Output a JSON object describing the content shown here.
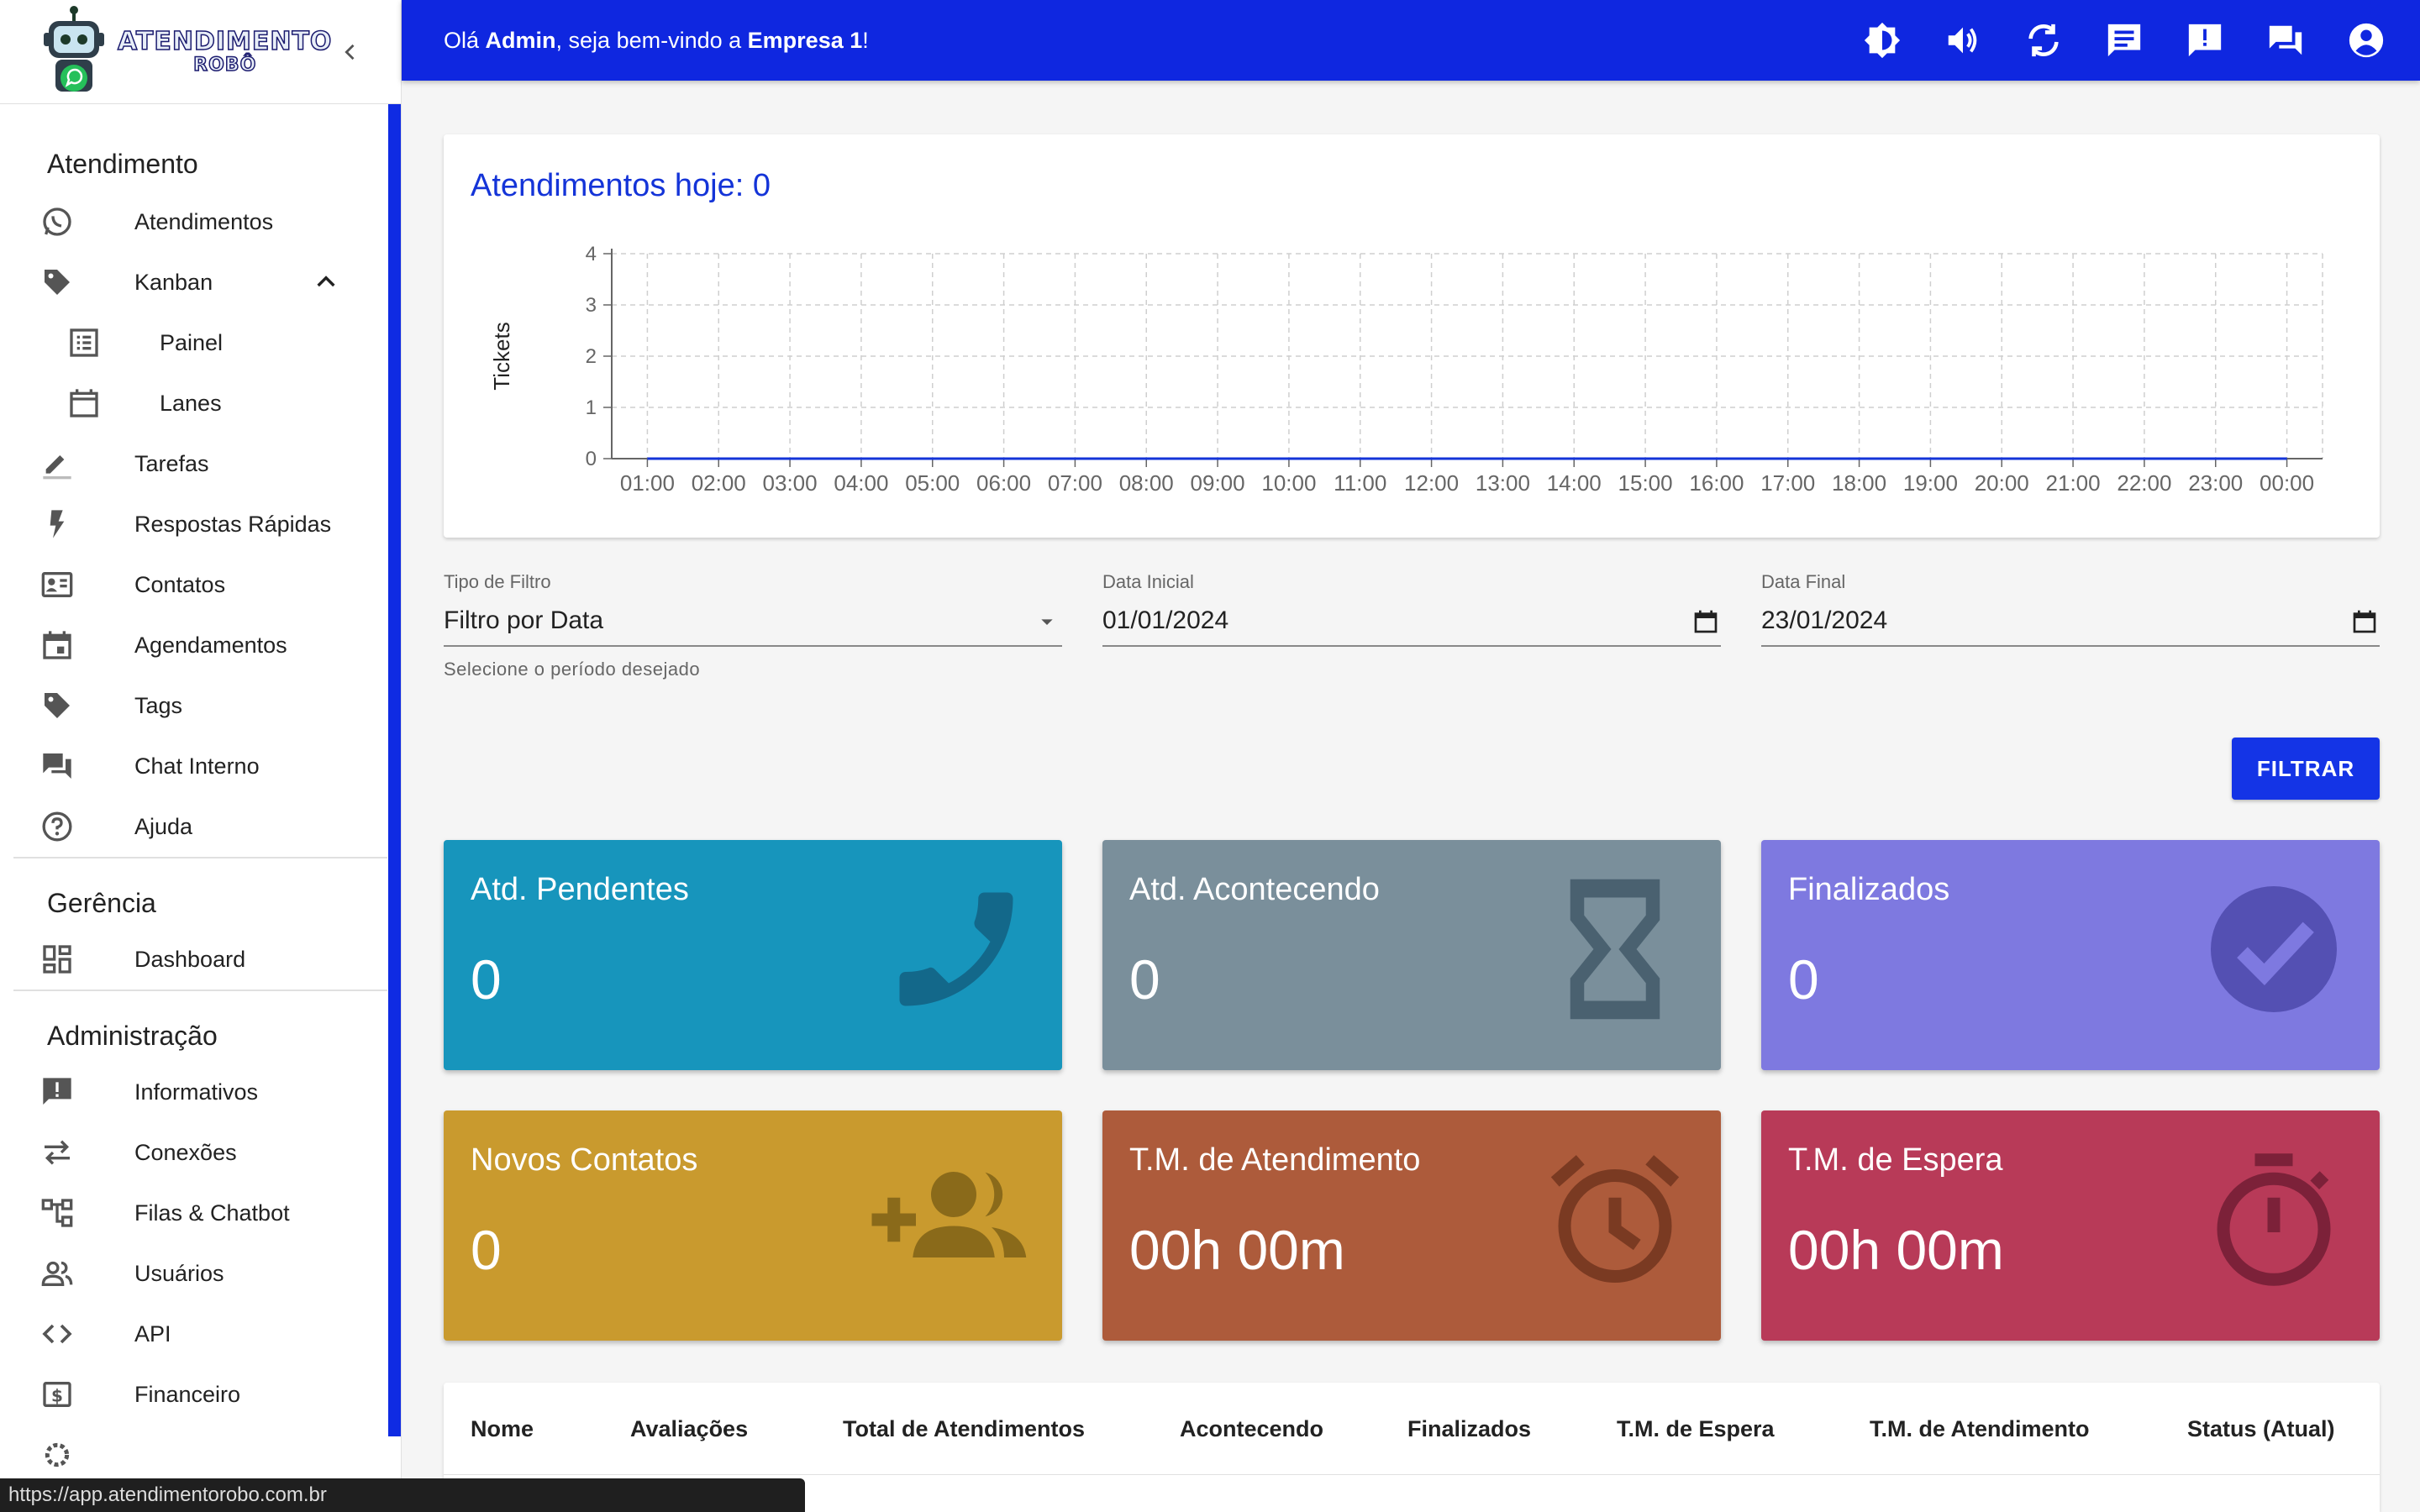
{
  "logo": {
    "line1": "ATENDIMENTO",
    "line2": "ROBÔ"
  },
  "sidebar": {
    "sections": [
      {
        "title": "Atendimento"
      },
      {
        "title": "Gerência"
      },
      {
        "title": "Administração"
      }
    ],
    "atendimento": [
      {
        "label": "Atendimentos",
        "icon": "whatsapp-icon"
      },
      {
        "label": "Kanban",
        "icon": "tag-icon"
      },
      {
        "label": "Painel",
        "icon": "list-icon"
      },
      {
        "label": "Lanes",
        "icon": "calendar-icon"
      },
      {
        "label": "Tarefas",
        "icon": "pencil-icon"
      },
      {
        "label": "Respostas Rápidas",
        "icon": "flash-icon"
      },
      {
        "label": "Contatos",
        "icon": "contact-card-icon"
      },
      {
        "label": "Agendamentos",
        "icon": "event-icon"
      },
      {
        "label": "Tags",
        "icon": "tag-icon"
      },
      {
        "label": "Chat Interno",
        "icon": "forum-icon"
      },
      {
        "label": "Ajuda",
        "icon": "help-icon"
      }
    ],
    "gerencia": [
      {
        "label": "Dashboard",
        "icon": "dashboard-icon"
      }
    ],
    "administracao": [
      {
        "label": "Informativos",
        "icon": "announcement-icon"
      },
      {
        "label": "Conexões",
        "icon": "sync-arrows-icon"
      },
      {
        "label": "Filas & Chatbot",
        "icon": "tree-icon"
      },
      {
        "label": "Usuários",
        "icon": "people-icon"
      },
      {
        "label": "API",
        "icon": "code-icon"
      },
      {
        "label": "Financeiro",
        "icon": "money-icon"
      }
    ]
  },
  "topbar": {
    "greeting_pre": "Olá ",
    "user": "Admin",
    "greeting_mid": ", seja bem-vindo a ",
    "company": "Empresa 1",
    "greeting_post": "!"
  },
  "chart_data": {
    "type": "line",
    "title": "Atendimentos hoje: 0",
    "ylabel": "Tickets",
    "xlabel": "",
    "ylim": [
      0,
      4
    ],
    "yticks": [
      "0",
      "1",
      "2",
      "3",
      "4"
    ],
    "categories": [
      "01:00",
      "02:00",
      "03:00",
      "04:00",
      "05:00",
      "06:00",
      "07:00",
      "08:00",
      "09:00",
      "10:00",
      "11:00",
      "12:00",
      "13:00",
      "14:00",
      "15:00",
      "16:00",
      "17:00",
      "18:00",
      "19:00",
      "20:00",
      "21:00",
      "22:00",
      "23:00",
      "00:00"
    ],
    "values": [
      0,
      0,
      0,
      0,
      0,
      0,
      0,
      0,
      0,
      0,
      0,
      0,
      0,
      0,
      0,
      0,
      0,
      0,
      0,
      0,
      0,
      0,
      0,
      0
    ],
    "grid": true
  },
  "filters": {
    "tipo": {
      "label": "Tipo de Filtro",
      "value": "Filtro por Data",
      "help": "Selecione o período desejado"
    },
    "inicial": {
      "label": "Data Inicial",
      "value": "01/01/2024"
    },
    "final": {
      "label": "Data Final",
      "value": "23/01/2024"
    },
    "button": "FILTRAR"
  },
  "cards": [
    {
      "title": "Atd. Pendentes",
      "value": "0",
      "color": "#1795bc",
      "icon": "phone-icon"
    },
    {
      "title": "Atd. Acontecendo",
      "value": "0",
      "color": "#7a8f9b",
      "icon": "hourglass-icon"
    },
    {
      "title": "Finalizados",
      "value": "0",
      "color": "#7e79e0",
      "icon": "check-circle-icon"
    },
    {
      "title": "Novos Contatos",
      "value": "0",
      "color": "#c99a2e",
      "icon": "group-add-icon"
    },
    {
      "title": "T.M. de Atendimento",
      "value": "00h 00m",
      "color": "#ad5b3b",
      "icon": "alarm-icon"
    },
    {
      "title": "T.M. de Espera",
      "value": "00h 00m",
      "color": "#b83a58",
      "icon": "timer-icon"
    }
  ],
  "table": {
    "headers": [
      "Nome",
      "Avaliações",
      "Total de Atendimentos",
      "Acontecendo",
      "Finalizados",
      "T.M. de Espera",
      "T.M. de Atendimento",
      "Status (Atual)"
    ]
  },
  "status_url": "https://app.atendimentorobo.com.br"
}
